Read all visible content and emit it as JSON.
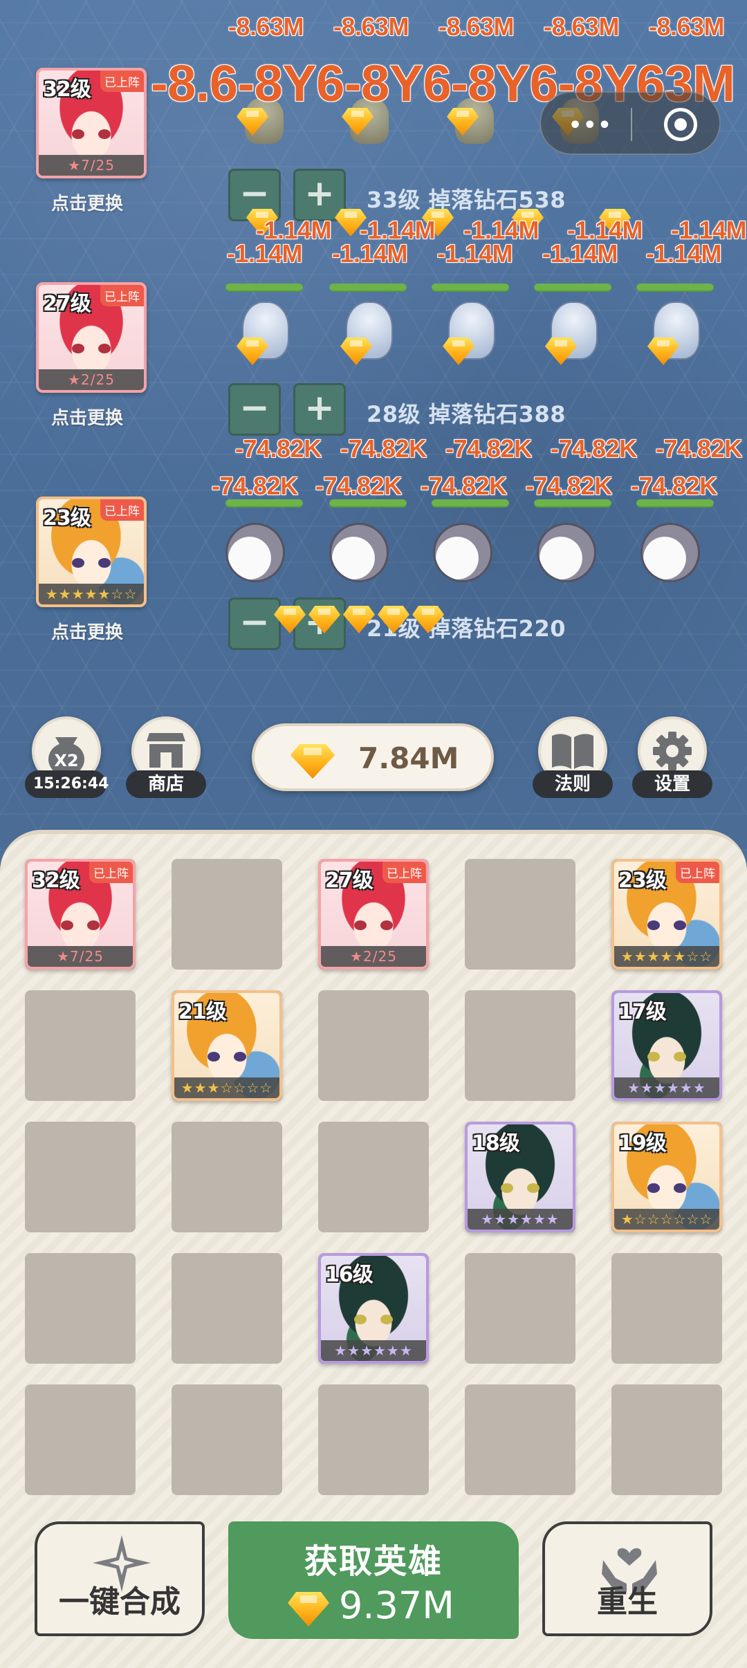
{
  "status": {
    "mini_dots": "•••"
  },
  "lanes": [
    {
      "level_text": "33级",
      "drop_label": "33级 掉落钻石538",
      "damage_big": "-8.6-8Y6-8Y6-8Y6-8Y63M",
      "damage_top": [
        "-8.63M",
        "-8.63M",
        "-8.63M",
        "-8.63M",
        "-8.63M"
      ]
    },
    {
      "drop_label": "28级 掉落钻石388",
      "damage_a": [
        "-1.14M",
        "-1.14M",
        "-1.14M",
        "-1.14M",
        "-1.14M"
      ],
      "damage_b": [
        "-1.14M",
        "-1.14M",
        "-1.14M",
        "-1.14M",
        "-1.14M"
      ]
    },
    {
      "drop_label": "21级 掉落钻石220",
      "damage_a": [
        "-74.82K",
        "-74.82K",
        "-74.82K",
        "-74.82K",
        "-74.82K"
      ],
      "damage_b": [
        "-74.82K",
        "-74.82K",
        "-74.82K",
        "-74.82K",
        "-74.82K"
      ]
    }
  ],
  "active_heroes": [
    {
      "level": "32级",
      "badge": "已上阵",
      "stars": "★7/25",
      "change": "点击更换"
    },
    {
      "level": "27级",
      "badge": "已上阵",
      "stars": "★2/25",
      "change": "点击更换"
    },
    {
      "level": "23级",
      "badge": "已上阵",
      "stars": "★★★★★☆☆",
      "change": "点击更换"
    }
  ],
  "controls": {
    "minus": "−",
    "plus": "+"
  },
  "top_bar": {
    "x2_label": "X2",
    "timer": "15:26:44",
    "shop": "商店",
    "gems": "7.84M",
    "rules": "法则",
    "settings": "设置"
  },
  "inventory": [
    {
      "level": "32级",
      "badge": "已上阵",
      "stars": "★7/25"
    },
    {
      "level": "27级",
      "badge": "已上阵",
      "stars": "★2/25"
    },
    {
      "level": "23级",
      "badge": "已上阵",
      "stars": "★★★★★☆☆"
    },
    {
      "level": "21级",
      "stars": "★★★☆☆☆☆"
    },
    {
      "level": "17级",
      "stars": "★★★★★★"
    },
    {
      "level": "18级",
      "stars": "★★★★★★"
    },
    {
      "level": "19级",
      "stars": "★☆☆☆☆☆☆"
    },
    {
      "level": "16级",
      "stars": "★★★★★★"
    }
  ],
  "bottom": {
    "merge": "一键合成",
    "summon_title": "获取英雄",
    "summon_cost": "9.37M",
    "rebirth": "重生"
  }
}
